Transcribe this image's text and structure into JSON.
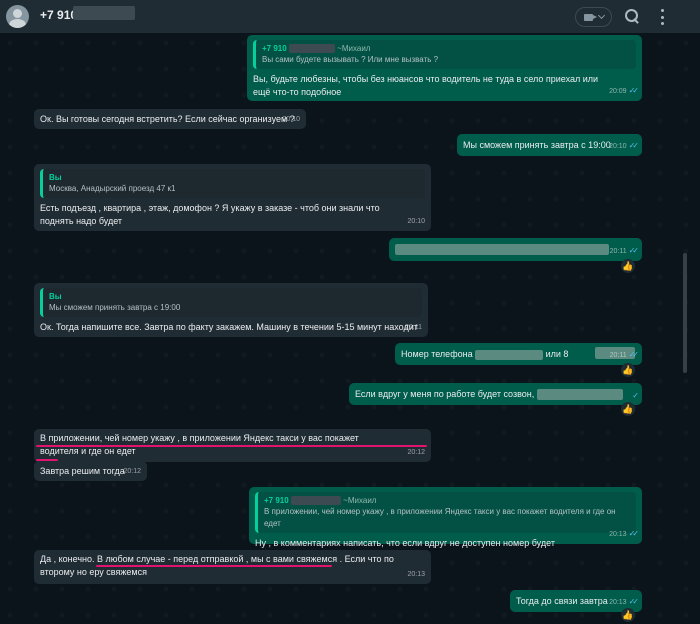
{
  "header": {
    "contact_name": "+7 910",
    "icons": [
      "avatar",
      "video-call-icon",
      "chevron-down-icon",
      "search-icon",
      "menu-icon"
    ]
  },
  "colors": {
    "incoming_bubble": "#202c33",
    "outgoing_bubble": "#005c4b",
    "quote_author": "#06cf9c",
    "read_ticks": "#53bdeb",
    "annotation_underline": "#e2136e"
  },
  "messages": {
    "m1": {
      "quote_author": "+7 910",
      "quote_suffix": "~Михаил",
      "quote_text": "Вы сами будете вызывать ? Или мне вызвать ?",
      "text": "Вы, будьте любезны, чтобы без нюансов что водитель не туда в село приехал или ещё что-то подобное",
      "time": "20:09"
    },
    "m2": {
      "text": "Ок. Вы готовы сегодня встретить? Если сейчас организуем ?",
      "time": "20:10"
    },
    "m3": {
      "text": "Мы сможем принять завтра с 19:00",
      "time": "20:10"
    },
    "m4": {
      "quote_author": "Вы",
      "quote_text": "Москва, Анадырский проезд 47 к1",
      "text": "Есть подъезд , квартира , этаж, домофон ? Я укажу в заказе - чтоб они знали что поднять надо будет",
      "time": "20:10"
    },
    "m5": {
      "time": "20:11",
      "reaction": "👍"
    },
    "m6": {
      "quote_author": "Вы",
      "quote_text": "Мы сможем принять завтра с 19:00",
      "text": "Ок. Тогда напишите все. Завтра по факту закажем. Машину в течении 5-15 минут находит",
      "time": "20:11"
    },
    "m7": {
      "text_prefix": "Номер телефона",
      "text_suffix": "или 8",
      "time": "20:11",
      "reaction": "👍"
    },
    "m8": {
      "text": "Если вдруг у меня по работе будет созвон,",
      "reaction": "👍"
    },
    "m9": {
      "text": "В приложении, чей номер укажу , в приложении Яндекс такси у вас покажет водителя и где он едет",
      "time": "20:12"
    },
    "m10": {
      "text": "Завтра решим тогда",
      "time": "20:12"
    },
    "m11": {
      "quote_author": "+7 910",
      "quote_suffix": "~Михаил",
      "quote_text": "В приложении, чей номер укажу , в приложении Яндекс такси у вас покажет водителя и где он едет",
      "text": "Ну , в комментариях написать, что если вдруг не доступен номер будет",
      "time": "20:13"
    },
    "m12": {
      "text": "Да , конечно. В любом случае - перед отправкой , мы с вами свяжемся . Если что по второму но еру свяжемся",
      "time": "20:13"
    },
    "m13": {
      "text": "Тогда до связи завтра",
      "time": "20:13",
      "reaction": "👍"
    }
  }
}
